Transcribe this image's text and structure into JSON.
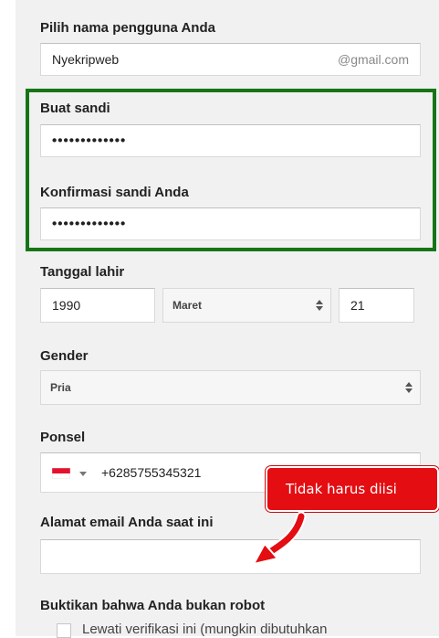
{
  "username": {
    "label": "Pilih nama pengguna Anda",
    "value": "Nyekripweb",
    "suffix": "@gmail.com"
  },
  "password": {
    "label": "Buat sandi",
    "value": "•••••••••••••"
  },
  "confirm_password": {
    "label": "Konfirmasi sandi Anda",
    "value": "•••••••••••••"
  },
  "birthdate": {
    "label": "Tanggal lahir",
    "year": "1990",
    "month": "Maret",
    "day": "21"
  },
  "gender": {
    "label": "Gender",
    "value": "Pria"
  },
  "phone": {
    "label": "Ponsel",
    "value": "+6285755345321",
    "flag_icon": "indonesia-flag-icon"
  },
  "current_email": {
    "label": "Alamat email Anda saat ini",
    "value": ""
  },
  "annotation": {
    "text": "Tidak harus diisi",
    "color": "#e30d12"
  },
  "robot": {
    "label": "Buktikan bahwa Anda bukan robot",
    "skip_label": "Lewati verifikasi ini (mungkin dibutuhkan"
  },
  "colors": {
    "highlight": "#177517",
    "annotation": "#e30d12"
  }
}
